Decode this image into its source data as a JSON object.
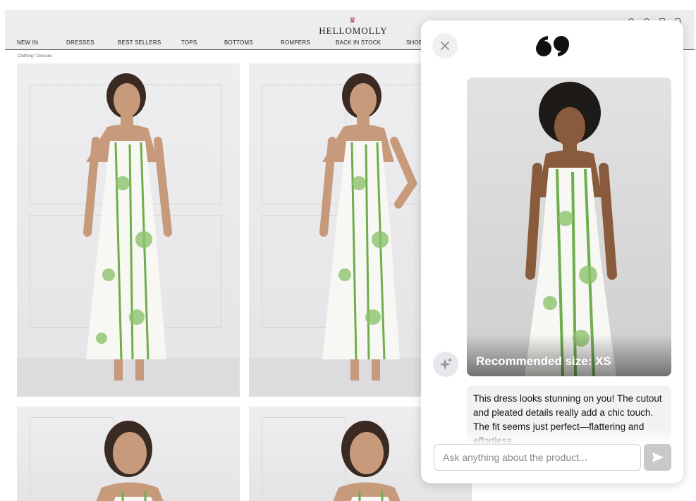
{
  "store": {
    "logo_text": "HELLOMOLLY",
    "nav": [
      "NEW IN",
      "DRESSES",
      "BEST SELLERS",
      "TOPS",
      "BOTTOMS",
      "ROMPERS",
      "BACK IN STOCK",
      "SHOE"
    ],
    "breadcrumb": "Clothing / Dresses",
    "header_icons": [
      "search-icon",
      "account-icon",
      "wishlist-icon",
      "bag-icon"
    ]
  },
  "products": [
    {
      "name": "product-photo-front"
    },
    {
      "name": "product-photo-side"
    },
    {
      "name": "product-photo-closeup-1"
    },
    {
      "name": "product-photo-closeup-2"
    }
  ],
  "chat": {
    "close_icon": "close-icon",
    "quote_icon": "quote-icon",
    "assistant_icon": "sparkle-icon",
    "recommendation": "Recommended size: XS",
    "message": "This dress looks stunning on you! The cutout and pleated details really add a chic touch. The fit seems just perfect—flattering and effortless.",
    "input_placeholder": "Ask anything about the product...",
    "send_icon": "send-icon"
  },
  "colors": {
    "dress_green": "#6fae4e",
    "send_button": "#c9c9cc",
    "bubble_bg": "#f2f2f3"
  }
}
